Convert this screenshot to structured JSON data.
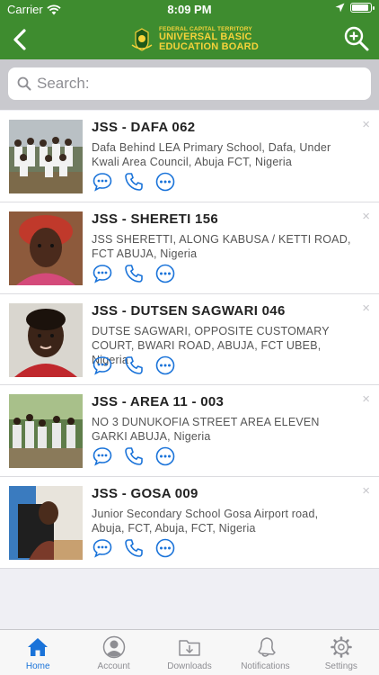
{
  "status_bar": {
    "carrier": "Carrier",
    "time": "8:09 PM"
  },
  "header": {
    "org_line1": "FEDERAL CAPITAL TERRITORY",
    "org_line2": "UNIVERSAL BASIC",
    "org_line3": "EDUCATION BOARD"
  },
  "search": {
    "placeholder": "Search:"
  },
  "schools": [
    {
      "name": "JSS - DAFA 062",
      "address": "Dafa Behind LEA Primary School, Dafa, Under Kwali Area Council, Abuja FCT, Nigeria"
    },
    {
      "name": "JSS - SHERETI 156",
      "address": "JSS SHERETTI, ALONG KABUSA / KETTI ROAD, FCT ABUJA, Nigeria"
    },
    {
      "name": "JSS - DUTSEN SAGWARI 046",
      "address": "DUTSE SAGWARI, OPPOSITE CUSTOMARY COURT, BWARI ROAD, ABUJA, FCT UBEB, Nigeria"
    },
    {
      "name": "JSS - AREA 11 - 003",
      "address": "NO 3 DUNUKOFIA STREET AREA ELEVEN GARKI ABUJA, Nigeria"
    },
    {
      "name": "JSS - GOSA 009",
      "address": "Junior Secondary School Gosa Airport road, Abuja, FCT, Abuja, FCT, Nigeria"
    }
  ],
  "item_close_glyph": "×",
  "tabs": [
    {
      "label": "Home",
      "icon": "home-icon",
      "active": true
    },
    {
      "label": "Account",
      "icon": "account-icon",
      "active": false
    },
    {
      "label": "Downloads",
      "icon": "downloads-icon",
      "active": false
    },
    {
      "label": "Notifications",
      "icon": "notifications-icon",
      "active": false
    },
    {
      "label": "Settings",
      "icon": "settings-icon",
      "active": false
    }
  ],
  "colors": {
    "header_green": "#3e8c2f",
    "accent_blue": "#1a73d9",
    "brand_yellow": "#f5d23a"
  }
}
